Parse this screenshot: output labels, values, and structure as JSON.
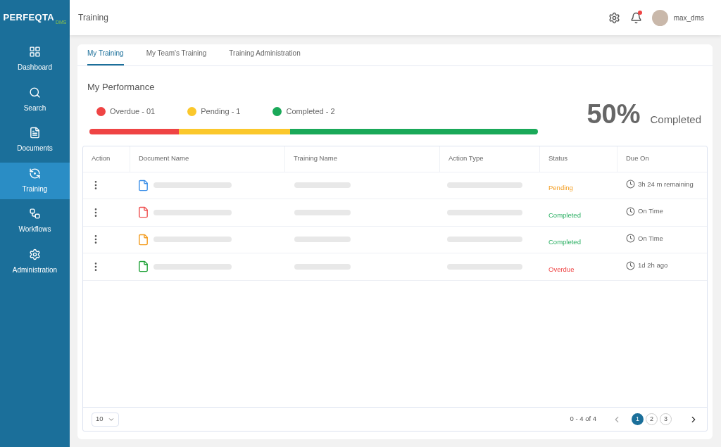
{
  "logo": {
    "name": "PERFEQTA",
    "suffix": "DMS"
  },
  "sidebar": {
    "items": [
      {
        "label": "Dashboard",
        "selected": false
      },
      {
        "label": "Search",
        "selected": false
      },
      {
        "label": "Documents",
        "selected": false
      },
      {
        "label": "Training",
        "selected": true
      },
      {
        "label": "Workflows",
        "selected": false
      },
      {
        "label": "Administration",
        "selected": false
      }
    ]
  },
  "header": {
    "title": "Training",
    "notification": true,
    "user": "max_dms"
  },
  "tabs": [
    {
      "label": "My Training",
      "selected": true
    },
    {
      "label": "My Team's Training",
      "selected": false
    },
    {
      "label": "Training Administration",
      "selected": false
    }
  ],
  "performance": {
    "title": "My Performance",
    "legend": [
      {
        "label": "Overdue - 01",
        "color": "#ef4444",
        "level": 0.2
      },
      {
        "label": "Pending - 1",
        "color": "#fbc82c",
        "level": 0.247
      },
      {
        "label": "Completed - 2",
        "color": "#1aa959",
        "level": 0.553
      }
    ],
    "percent": "50%",
    "percent_label": "Completed"
  },
  "table": {
    "columns": [
      "Action",
      "Document Name",
      "Training Name",
      "Action Type",
      "Status",
      "Due On"
    ],
    "rows": [
      {
        "kind": "doc",
        "status": {
          "label": "Pending",
          "kind": "pending"
        },
        "due": "3h 24 m remaining"
      },
      {
        "kind": "pdf",
        "status": {
          "label": "Completed",
          "kind": "completed"
        },
        "due": "On Time"
      },
      {
        "kind": "ppt",
        "status": {
          "label": "Completed",
          "kind": "completed"
        },
        "due": "On Time"
      },
      {
        "kind": "xls",
        "status": {
          "label": "Overdue",
          "kind": "overdue"
        },
        "due": "1d 2h ago"
      }
    ]
  },
  "footer": {
    "page_size": "10",
    "range": "0 - 4 of 4",
    "pages": [
      {
        "label": "1",
        "selected": true
      },
      {
        "label": "2",
        "selected": false
      },
      {
        "label": "3",
        "selected": false
      }
    ]
  }
}
